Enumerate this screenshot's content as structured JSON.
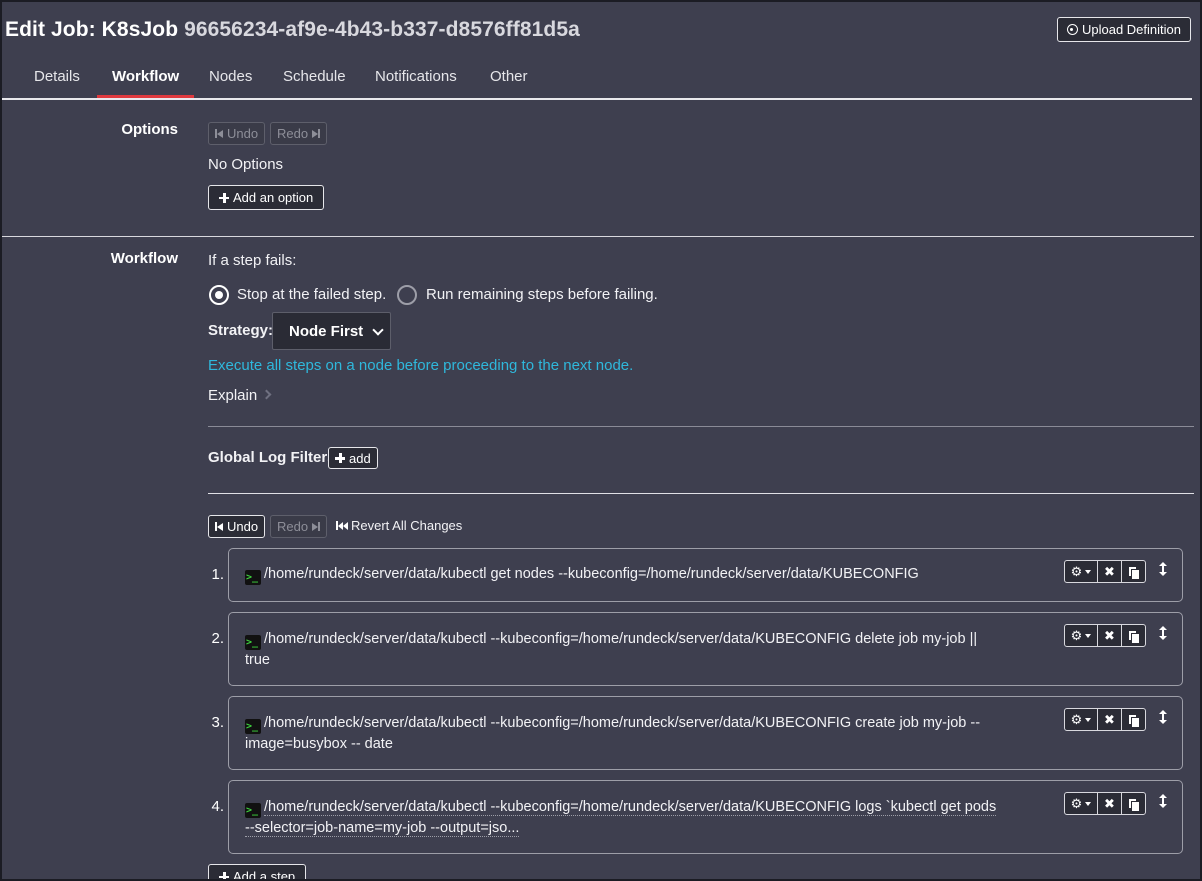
{
  "header": {
    "title_prefix": "Edit Job: K8sJob",
    "job_uuid": "96656234-af9e-4b43-b337-d8576ff81d5a",
    "upload_label": "Upload Definition"
  },
  "tabs": [
    {
      "label": "Details"
    },
    {
      "label": "Workflow",
      "active": true
    },
    {
      "label": "Nodes"
    },
    {
      "label": "Schedule"
    },
    {
      "label": "Notifications"
    },
    {
      "label": "Other"
    }
  ],
  "options": {
    "label": "Options",
    "undo": "Undo",
    "redo": "Redo",
    "empty_text": "No Options",
    "add_label": "Add an option"
  },
  "workflow": {
    "label": "Workflow",
    "fail_prompt": "If a step fails:",
    "radio_stop": "Stop at the failed step.",
    "radio_run": "Run remaining steps before failing.",
    "strategy_label": "Strategy:",
    "strategy_value": "Node First",
    "strategy_desc": "Execute all steps on a node before proceeding to the next node.",
    "explain": "Explain",
    "log_filters_label": "Global Log Filters",
    "log_filters_add": "add",
    "undo": "Undo",
    "redo": "Redo",
    "revert": "Revert All Changes",
    "add_step": "Add a step",
    "accent_color": "#2fb8dc"
  },
  "steps": [
    {
      "num": "1.",
      "line1": "/home/rundeck/server/data/kubectl get nodes --kubeconfig=/home/rundeck/server/data/KUBECONFIG",
      "line2": ""
    },
    {
      "num": "2.",
      "line1": "/home/rundeck/server/data/kubectl --kubeconfig=/home/rundeck/server/data/KUBECONFIG delete job my-job ||",
      "line2": "true"
    },
    {
      "num": "3.",
      "line1": "/home/rundeck/server/data/kubectl --kubeconfig=/home/rundeck/server/data/KUBECONFIG create job my-job --",
      "line2": "image=busybox -- date"
    },
    {
      "num": "4.",
      "line1": "/home/rundeck/server/data/kubectl --kubeconfig=/home/rundeck/server/data/KUBECONFIG logs `kubectl get pods",
      "line2": "--selector=job-name=my-job --output=jso..."
    }
  ]
}
